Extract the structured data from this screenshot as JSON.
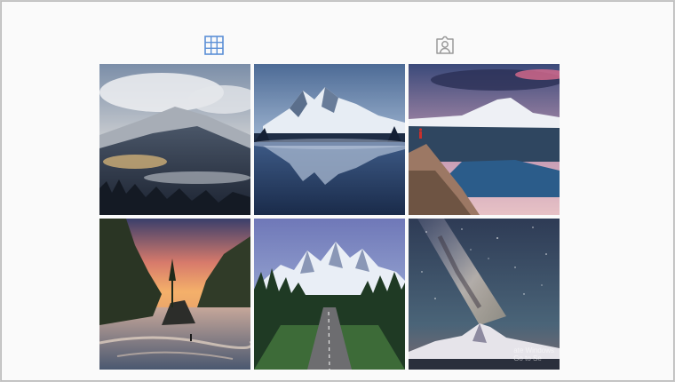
{
  "tabs": [
    {
      "icon": "grid-icon",
      "active": true
    },
    {
      "icon": "tagged-person-icon",
      "active": false
    }
  ],
  "colors": {
    "active_tab": "#5b8fd6",
    "inactive_tab": "#9a9a9a",
    "page_background": "#fafafa"
  },
  "photos": [
    {
      "subject": "misty mountain above clouds"
    },
    {
      "subject": "snowy peak reflected in lake"
    },
    {
      "subject": "mountain overlook with hiker in red"
    },
    {
      "subject": "coastal sunset with sea stacks"
    },
    {
      "subject": "jagged peaks above forest road"
    },
    {
      "subject": "milky way over snowy mountain"
    }
  ],
  "watermark": {
    "line1": "ate Windows",
    "line2": "Go to Se"
  }
}
